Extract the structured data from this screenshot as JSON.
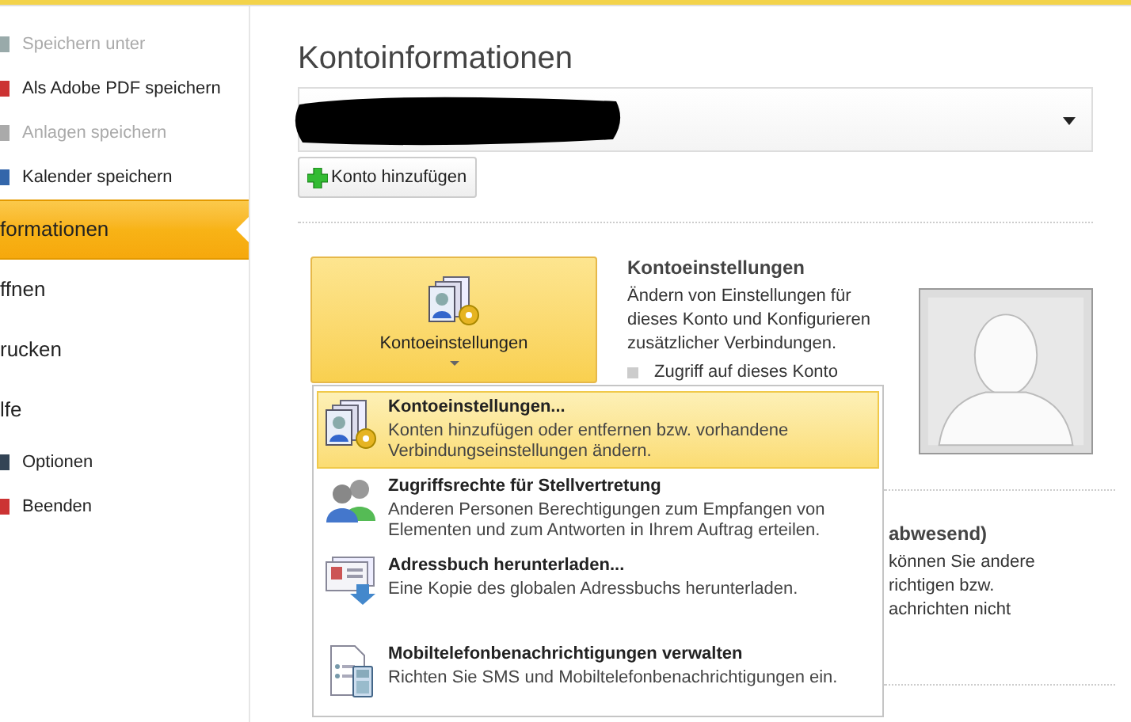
{
  "sidebar": {
    "items": [
      {
        "label": "Speichern unter",
        "kind": "small",
        "disabled": true,
        "selected": false
      },
      {
        "label": "Als Adobe PDF speichern",
        "kind": "small",
        "disabled": false,
        "selected": false
      },
      {
        "label": "Anlagen speichern",
        "kind": "small",
        "disabled": true,
        "selected": false
      },
      {
        "label": "Kalender speichern",
        "kind": "small",
        "disabled": false,
        "selected": false
      },
      {
        "label": "formationen",
        "kind": "large",
        "disabled": false,
        "selected": true
      },
      {
        "label": "ffnen",
        "kind": "large",
        "disabled": false,
        "selected": false
      },
      {
        "label": "rucken",
        "kind": "large",
        "disabled": false,
        "selected": false
      },
      {
        "label": "lfe",
        "kind": "large",
        "disabled": false,
        "selected": false
      },
      {
        "label": "Optionen",
        "kind": "small",
        "disabled": false,
        "selected": false
      },
      {
        "label": "Beenden",
        "kind": "small",
        "disabled": false,
        "selected": false
      }
    ]
  },
  "main": {
    "title": "Kontoinformationen",
    "add_account_button": "Konto hinzufügen",
    "account_settings": {
      "button": "Kontoeinstellungen",
      "title": "Kontoeinstellungen",
      "description": "Ändern von Einstellungen für dieses Konto und Konfigurieren zusätzlicher Verbindungen.",
      "bullet": "Zugriff auf dieses Konto"
    },
    "behind_menu": [
      "abwesend)",
      "können Sie andere",
      "richtigen bzw.",
      "achrichten nicht"
    ]
  },
  "menu": {
    "items": [
      {
        "kind": "settings",
        "title": "Kontoeinstellungen...",
        "description": "Konten hinzufügen oder entfernen bzw. vorhandene Verbindungseinstellungen ändern.",
        "selected": true
      },
      {
        "kind": "delegates",
        "title": "Zugriffsrechte für Stellvertretung",
        "description": "Anderen Personen Berechtigungen zum Empfangen von Elementen und zum Antworten in Ihrem Auftrag erteilen.",
        "selected": false
      },
      {
        "kind": "addressbook",
        "title": "Adressbuch herunterladen...",
        "description": "Eine Kopie des globalen Adressbuchs herunterladen.",
        "selected": false
      },
      {
        "kind": "mobile",
        "title": "Mobiltelefonbenachrichtigungen verwalten",
        "description": "Richten Sie SMS und Mobiltelefonbenachrichtigungen ein.",
        "selected": false
      }
    ]
  }
}
